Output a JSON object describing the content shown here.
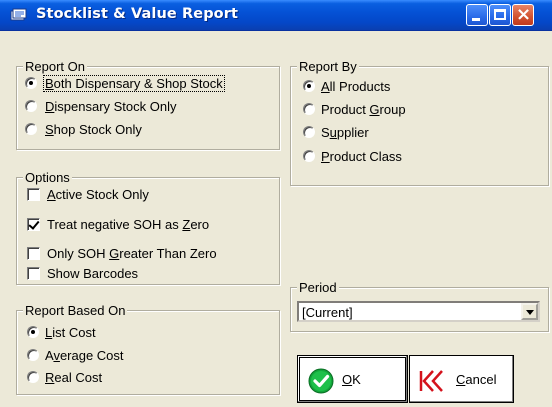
{
  "window": {
    "title": "Stocklist & Value Report"
  },
  "report_on": {
    "title": "Report On",
    "options": [
      {
        "pre": "",
        "key": "B",
        "post": "oth Dispensary & Shop Stock",
        "selected": true
      },
      {
        "pre": "",
        "key": "D",
        "post": "ispensary Stock Only",
        "selected": false
      },
      {
        "pre": "",
        "key": "S",
        "post": "hop Stock Only",
        "selected": false
      }
    ]
  },
  "options": {
    "title": "Options",
    "items": [
      {
        "pre": "",
        "key": "A",
        "post": "ctive Stock Only",
        "checked": false
      },
      {
        "pre": "Treat negative SOH as ",
        "key": "Z",
        "post": "ero",
        "checked": true
      },
      {
        "pre": "Only SOH ",
        "key": "G",
        "post": "reater Than Zero",
        "checked": false
      },
      {
        "pre": "Show Barcodes",
        "key": "",
        "post": "",
        "checked": false
      }
    ]
  },
  "report_based_on": {
    "title": "Report Based On",
    "options": [
      {
        "pre": "",
        "key": "L",
        "post": "ist Cost",
        "selected": true
      },
      {
        "pre": "A",
        "key": "v",
        "post": "erage Cost",
        "selected": false
      },
      {
        "pre": "",
        "key": "R",
        "post": "eal Cost",
        "selected": false
      }
    ]
  },
  "report_by": {
    "title": "Report By",
    "options": [
      {
        "pre": "",
        "key": "A",
        "post": "ll Products",
        "selected": true
      },
      {
        "pre": "Product ",
        "key": "G",
        "post": "roup",
        "selected": false
      },
      {
        "pre": "S",
        "key": "u",
        "post": "pplier",
        "selected": false
      },
      {
        "pre": "",
        "key": "P",
        "post": "roduct Class",
        "selected": false
      }
    ]
  },
  "period": {
    "title": "Period",
    "value": "[Current]"
  },
  "buttons": {
    "ok": {
      "pre": "",
      "key": "O",
      "post": "K"
    },
    "cancel": {
      "pre": "",
      "key": "C",
      "post": "ancel"
    }
  },
  "colors": {
    "titlebar": "#0552d6",
    "ok_icon": "#12a53a",
    "cancel_icon": "#d4121c"
  },
  "icons": {
    "title": "report-icon",
    "ok": "checkmark-circle-icon",
    "cancel": "rewind-icon"
  }
}
